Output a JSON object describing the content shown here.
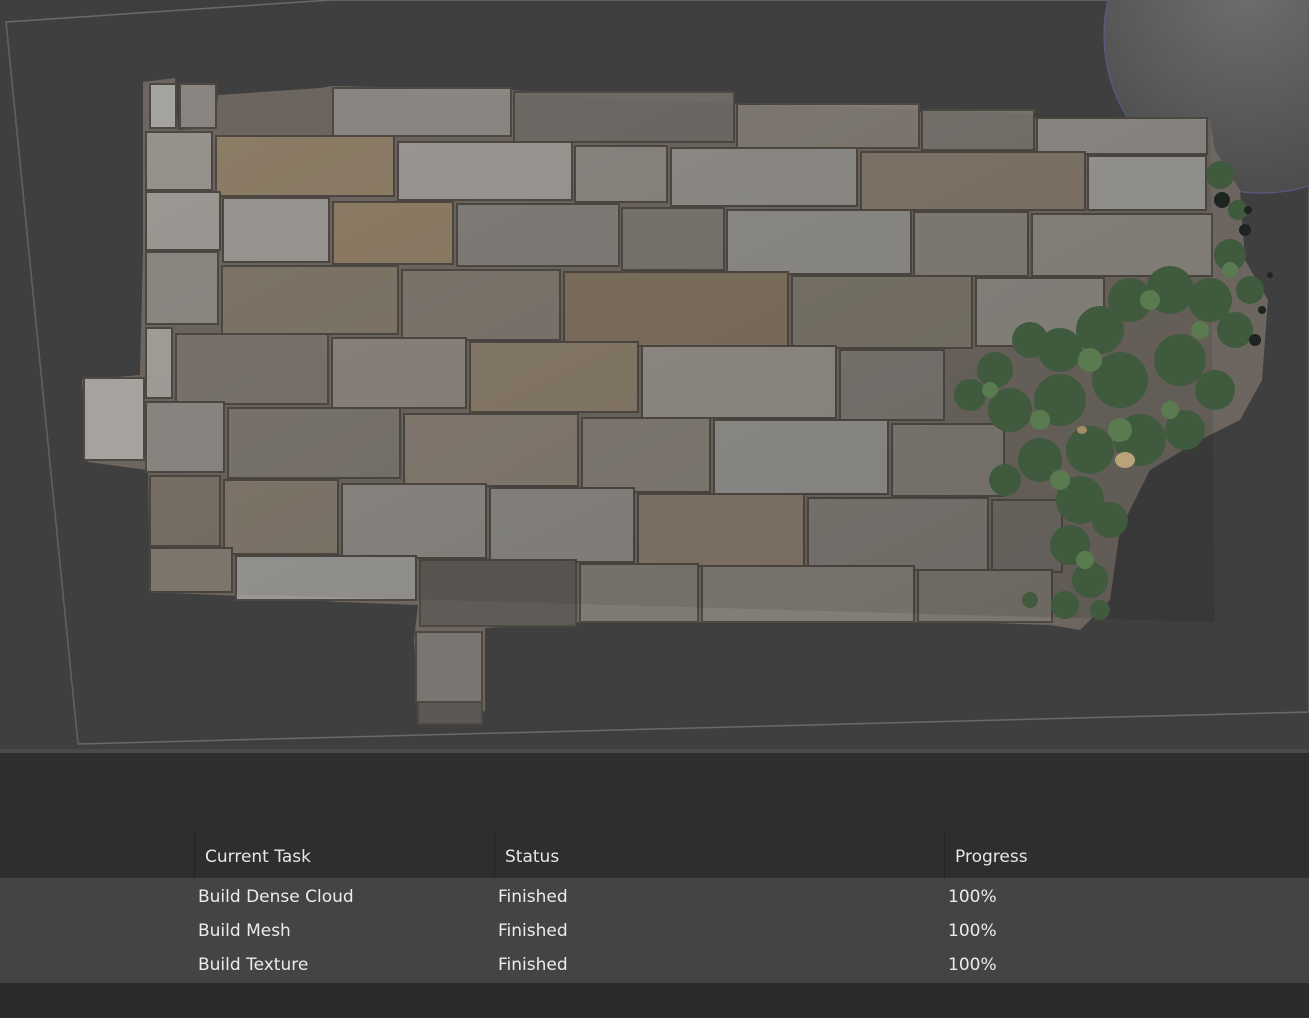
{
  "viewport": {
    "scene": "textured-stone-wall-model",
    "colors": {
      "background": "#3f3f3f",
      "bounding_box": "#6a6a6a",
      "trackball_edge": "#5a5a8a"
    }
  },
  "task_table": {
    "headers": {
      "task": "Current Task",
      "status": "Status",
      "progress": "Progress"
    },
    "rows": [
      {
        "task": "Build Dense Cloud",
        "status": "Finished",
        "progress": "100%"
      },
      {
        "task": "Build Mesh",
        "status": "Finished",
        "progress": "100%"
      },
      {
        "task": "Build Texture",
        "status": "Finished",
        "progress": "100%"
      }
    ]
  }
}
